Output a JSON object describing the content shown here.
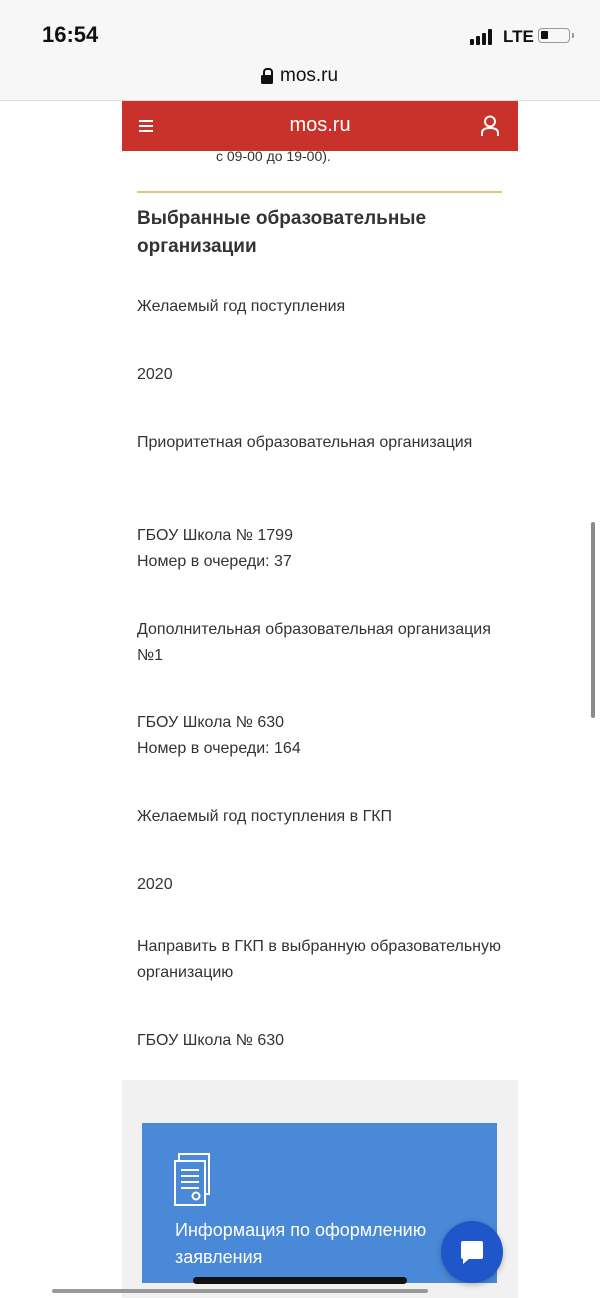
{
  "status_bar": {
    "time": "16:54",
    "network": "LTE"
  },
  "browser": {
    "url": "mos.ru"
  },
  "site_header": {
    "title": "mos.ru"
  },
  "content": {
    "cut_text": "с 09-00 до 19-00).",
    "section_title": "Выбранные образовательные организации",
    "fields": [
      {
        "text": "Желаемый год поступления"
      },
      {
        "text": "2020"
      },
      {
        "text": "Приоритетная образовательная организация"
      },
      {
        "text": "ГБОУ Школа № 1799",
        "sub": "Номер в очереди: 37"
      },
      {
        "text": "Дополнительная образовательная организация №1"
      },
      {
        "text": "ГБОУ Школа № 630",
        "sub": "Номер в очереди: 164"
      },
      {
        "text": "Желаемый год поступления в ГКП"
      },
      {
        "text": "2020"
      },
      {
        "text": "Направить в ГКП в выбранную образовательную организацию"
      },
      {
        "text": "ГБОУ Школа № 630"
      }
    ]
  },
  "info_card": {
    "label": "Информация по оформлению заявления",
    "icon": "document-icon"
  },
  "chat": {
    "icon": "chat-icon"
  },
  "colors": {
    "header_red": "#c8322a",
    "card_blue": "#4a88d8",
    "chat_blue": "#1f56c9",
    "divider_gold": "#e3c77f"
  }
}
